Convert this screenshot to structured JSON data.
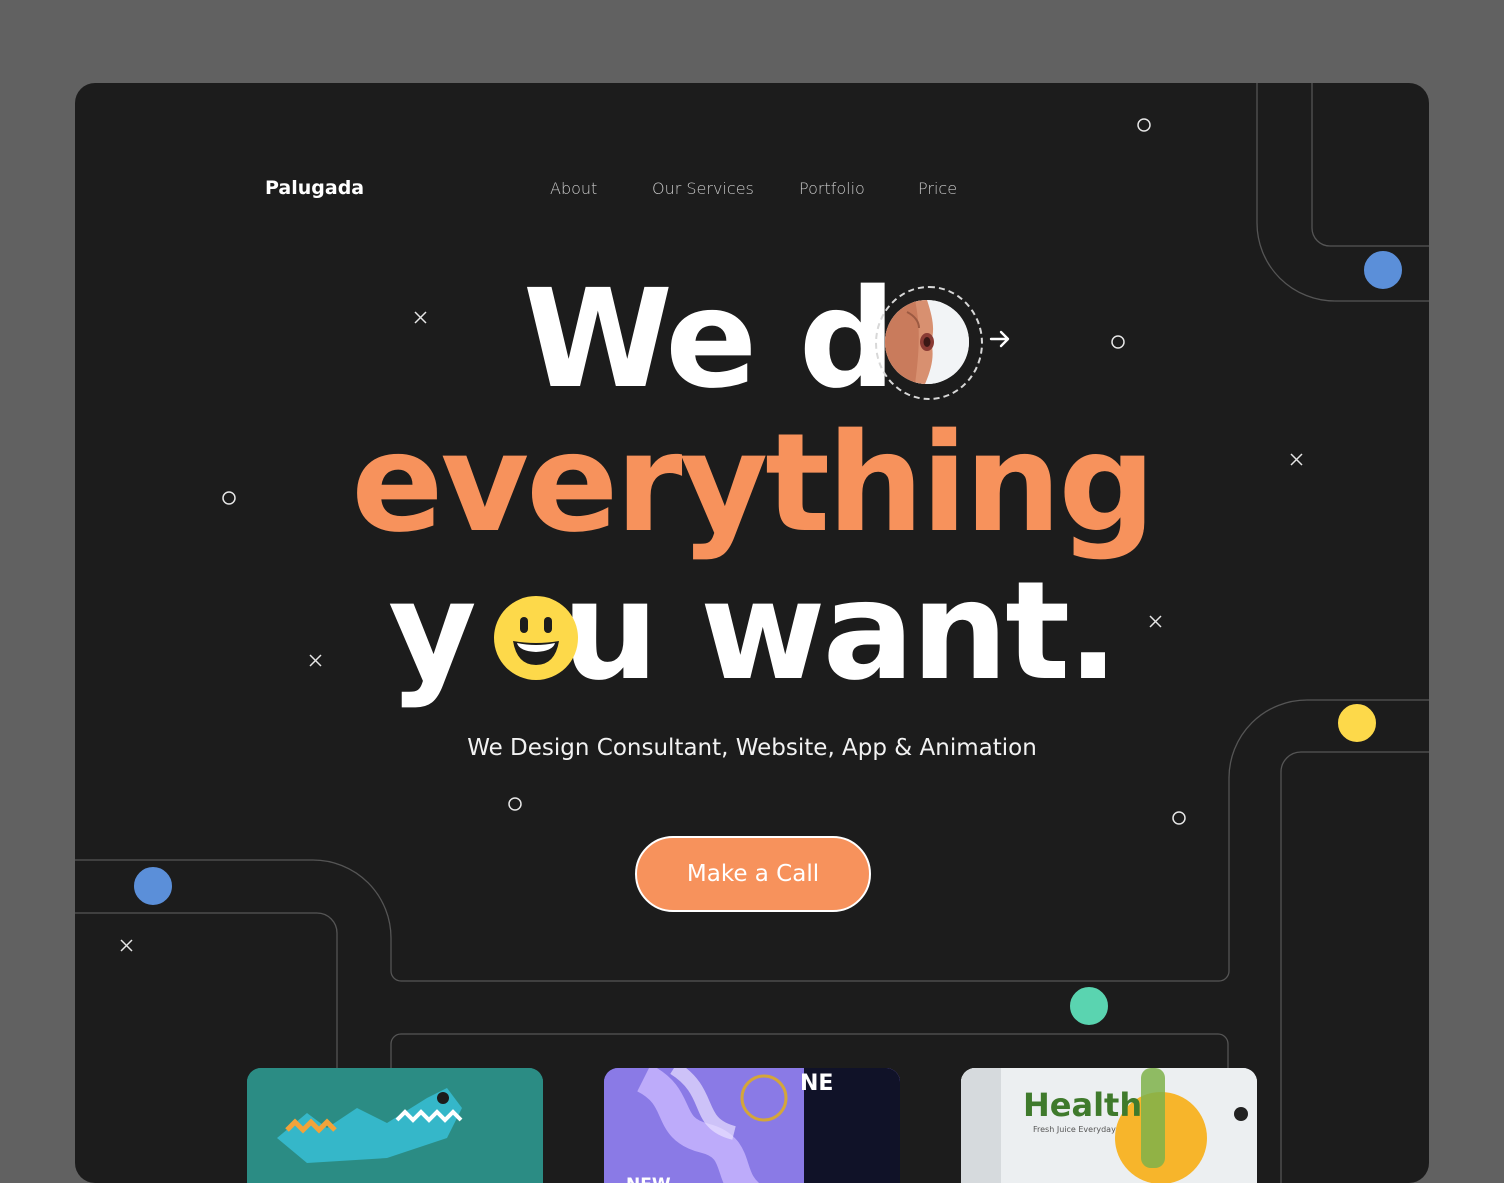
{
  "brand": {
    "name": "Palugada"
  },
  "nav": {
    "items": [
      "About",
      "Our Services",
      "Portfolio",
      "Price"
    ]
  },
  "hero": {
    "line1_part1": "We d",
    "line2": "everything",
    "line3_part1": "y",
    "line3_part2": "u want.",
    "subtitle": "We Design Consultant, Website, App & Animation",
    "cta_label": "Make a Call"
  },
  "portfolio": {
    "items": [
      {
        "name": "crocodile-illustration"
      },
      {
        "name": "new-universe",
        "text": "NEW UNIVERSE",
        "corner": "NE"
      },
      {
        "name": "health-drink",
        "text": "Health Dri",
        "sub": "Fresh Juice Everyday"
      }
    ]
  },
  "colors": {
    "accent": "#f7925c",
    "blue_dot": "#5b8fd9",
    "yellow_dot": "#fdd94a",
    "teal_dot": "#5ad4b0",
    "background": "#1c1c1c"
  }
}
